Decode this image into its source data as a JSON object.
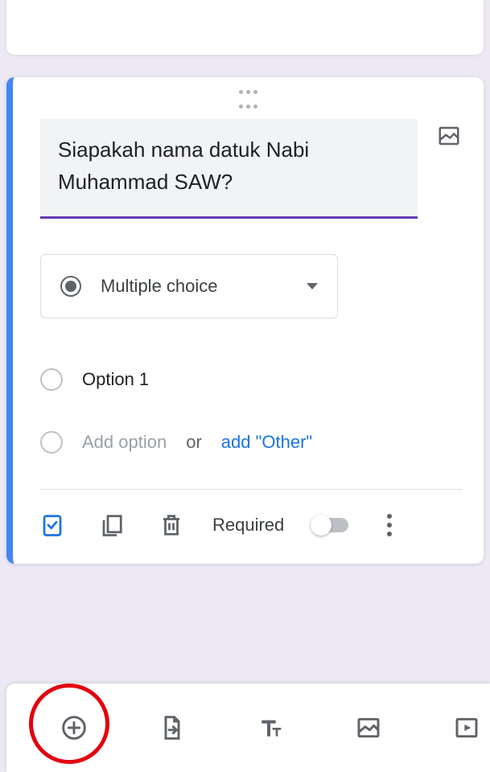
{
  "question": {
    "title": "Siapakah nama datuk Nabi Muhammad SAW?",
    "type_label": "Multiple choice",
    "options": [
      "Option 1"
    ],
    "add_option_text": "Add option",
    "or_text": "or",
    "add_other_text": "add \"Other\"",
    "required_label": "Required",
    "required_state": false
  }
}
